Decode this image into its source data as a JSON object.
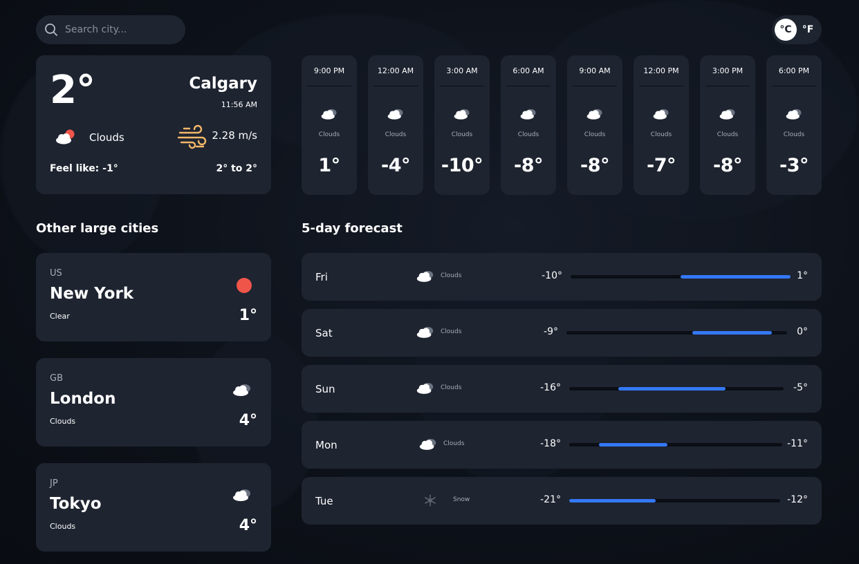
{
  "search": {
    "placeholder": "Search city..."
  },
  "units": {
    "celsius": "°C",
    "fahrenheit": "°F",
    "selected": "celsius"
  },
  "current": {
    "temp": "2°",
    "city": "Calgary",
    "time": "11:56 AM",
    "condition": "Clouds",
    "condition_icon": "cloud-sun-icon",
    "wind": "2.28 m/s",
    "wind_icon": "wind-icon",
    "feels_like": "Feel like: -1°",
    "range": "2° to 2°"
  },
  "hourly": [
    {
      "time": "9:00 PM",
      "condition": "Clouds",
      "temp": "1°"
    },
    {
      "time": "12:00 AM",
      "condition": "Clouds",
      "temp": "-4°"
    },
    {
      "time": "3:00 AM",
      "condition": "Clouds",
      "temp": "-10°"
    },
    {
      "time": "6:00 AM",
      "condition": "Clouds",
      "temp": "-8°"
    },
    {
      "time": "9:00 AM",
      "condition": "Clouds",
      "temp": "-8°"
    },
    {
      "time": "12:00 PM",
      "condition": "Clouds",
      "temp": "-7°"
    },
    {
      "time": "3:00 PM",
      "condition": "Clouds",
      "temp": "-8°"
    },
    {
      "time": "6:00 PM",
      "condition": "Clouds",
      "temp": "-3°"
    }
  ],
  "other_cities": {
    "heading": "Other large cities",
    "items": [
      {
        "country": "US",
        "name": "New York",
        "condition": "Clear",
        "temp": "1°",
        "icon": "sun-icon"
      },
      {
        "country": "GB",
        "name": "London",
        "condition": "Clouds",
        "temp": "4°",
        "icon": "cloud-icon"
      },
      {
        "country": "JP",
        "name": "Tokyo",
        "condition": "Clouds",
        "temp": "4°",
        "icon": "cloud-icon"
      }
    ]
  },
  "forecast": {
    "heading": "5-day forecast",
    "days": [
      {
        "day": "Fri",
        "condition": "Clouds",
        "icon": "cloud-icon",
        "min": "-10°",
        "max": "1°",
        "bar_start": 0.5,
        "bar_end": 1.0
      },
      {
        "day": "Sat",
        "condition": "Clouds",
        "icon": "cloud-icon",
        "min": "-9°",
        "max": "0°",
        "bar_start": 0.57,
        "bar_end": 0.93
      },
      {
        "day": "Sun",
        "condition": "Clouds",
        "icon": "cloud-icon",
        "min": "-16°",
        "max": "-5°",
        "bar_start": 0.23,
        "bar_end": 0.73
      },
      {
        "day": "Mon",
        "condition": "Clouds",
        "icon": "cloud-icon",
        "min": "-18°",
        "max": "-11°",
        "bar_start": 0.14,
        "bar_end": 0.46
      },
      {
        "day": "Tue",
        "condition": "Snow",
        "icon": "snowflake-icon",
        "min": "-21°",
        "max": "-12°",
        "bar_start": 0.0,
        "bar_end": 0.41
      }
    ]
  },
  "colors": {
    "card": "#1e2430",
    "accent_bar": "#3478f6",
    "sun": "#f0554a",
    "wind_icon": "#f4b86a"
  }
}
